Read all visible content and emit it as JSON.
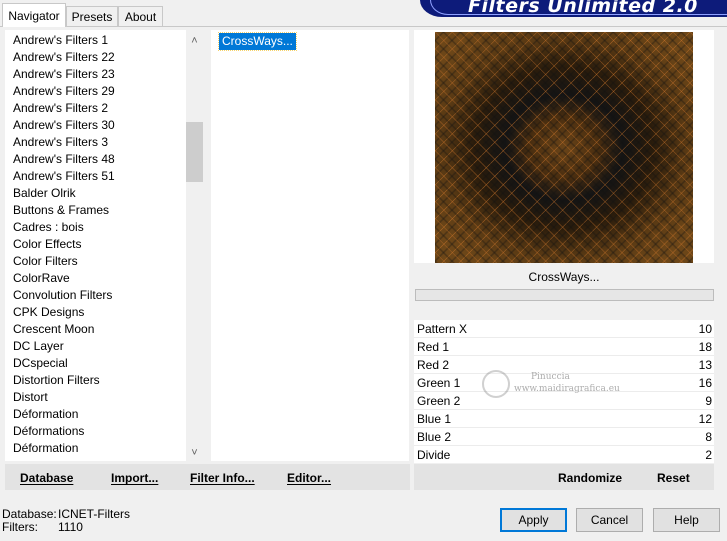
{
  "tabs": [
    {
      "label": "Navigator",
      "active": true
    },
    {
      "label": "Presets",
      "active": false
    },
    {
      "label": "About",
      "active": false
    }
  ],
  "banner": {
    "title": "Filters Unlimited 2.0"
  },
  "categories": [
    "Andrew's Filters 1",
    "Andrew's Filters 22",
    "Andrew's Filters 23",
    "Andrew's Filters 29",
    "Andrew's Filters 2",
    "Andrew's Filters 30",
    "Andrew's Filters 3",
    "Andrew's Filters 48",
    "Andrew's Filters 51",
    "Balder Olrik",
    "Buttons & Frames",
    "Cadres : bois",
    "Color Effects",
    "Color Filters",
    "ColorRave",
    "Convolution Filters",
    "CPK Designs",
    "Crescent Moon",
    "DC Layer",
    "DCspecial",
    "Distortion Filters",
    "Distort",
    "Déformation",
    "Déformations",
    "Déformation"
  ],
  "filters": [
    {
      "label": "CrossWays...",
      "selected": true
    }
  ],
  "preview": {
    "filter_name": "CrossWays..."
  },
  "progress": 0,
  "params": [
    {
      "label": "Pattern X",
      "value": "10"
    },
    {
      "label": "Red 1",
      "value": "18"
    },
    {
      "label": "Red 2",
      "value": "13"
    },
    {
      "label": "Green 1",
      "value": "16"
    },
    {
      "label": "Green 2",
      "value": "9"
    },
    {
      "label": "Blue 1",
      "value": "12"
    },
    {
      "label": "Blue 2",
      "value": "8"
    },
    {
      "label": "Divide",
      "value": "2"
    }
  ],
  "watermark": {
    "line1": "Pinuccia",
    "line2": "www.maidiragrafica.eu"
  },
  "toolbar": {
    "database": "Database",
    "import": "Import...",
    "filter_info": "Filter Info...",
    "editor": "Editor...",
    "randomize": "Randomize",
    "reset": "Reset"
  },
  "status": {
    "database_label": "Database:",
    "database_value": "ICNET-Filters",
    "filters_label": "Filters:",
    "filters_value": "1110"
  },
  "buttons": {
    "apply": "Apply",
    "cancel": "Cancel",
    "help": "Help"
  },
  "colors": {
    "accent": "#0078d7",
    "banner": "#0d1b7a",
    "preview_lines": "#c8742a"
  }
}
